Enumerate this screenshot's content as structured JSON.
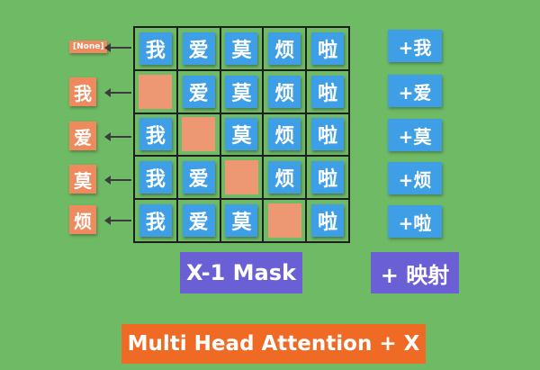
{
  "grid": [
    [
      "我",
      "爱",
      "莫",
      "烦",
      "啦"
    ],
    [
      "",
      "爱",
      "莫",
      "烦",
      "啦"
    ],
    [
      "我",
      "",
      "莫",
      "烦",
      "啦"
    ],
    [
      "我",
      "爱",
      "",
      "烦",
      "啦"
    ],
    [
      "我",
      "爱",
      "莫",
      "",
      "啦"
    ]
  ],
  "outputs": [
    "[None]",
    "我",
    "爱",
    "莫",
    "烦"
  ],
  "additions": [
    "+我",
    "+爱",
    "+莫",
    "+烦",
    "+啦"
  ],
  "mask_label": "X-1 Mask",
  "mapping_label": "+ 映射",
  "title": "Multi Head Attention + X",
  "colors": {
    "background": "#6fba65",
    "token": "#3f9fe6",
    "mask": "#ee9773",
    "output": "#ee8a5e",
    "mask_label_bg": "#6b5fd6",
    "title_bg": "#ee6a25"
  }
}
